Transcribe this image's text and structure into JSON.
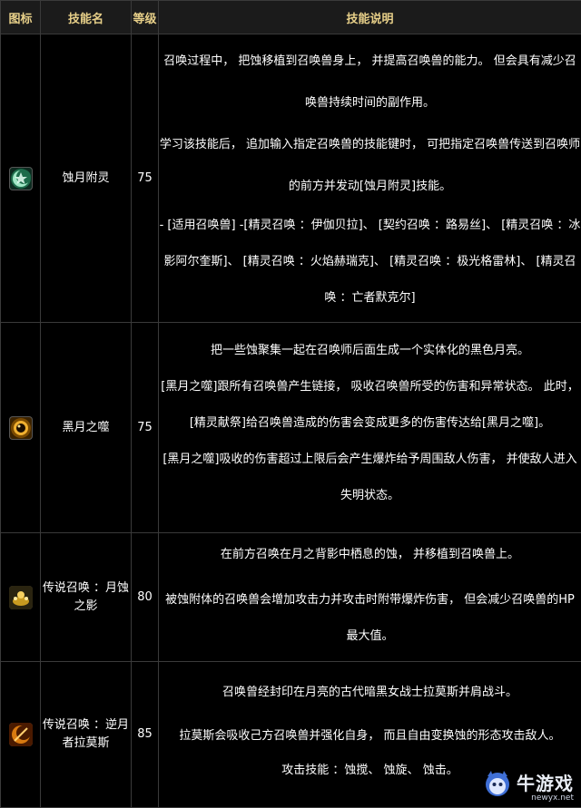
{
  "header": {
    "icon": "图标",
    "name": "技能名",
    "level": "等级",
    "desc": "技能说明"
  },
  "rows": [
    {
      "icon": "moon-star-icon",
      "name": "蚀月附灵",
      "level": "75",
      "desc": [
        "召唤过程中， 把蚀移植到召唤兽身上， 并提高召唤兽的能力。 但会具有减少召唤兽持续时间的副作用。",
        "学习该技能后， 追加输入指定召唤兽的技能键时， 可把指定召唤兽传送到召唤师的前方并发动[蚀月附灵]技能。",
        "- [适用召唤兽] -[精灵召唤 ：伊伽贝拉]、 [契约召唤 ：路易丝]、 [精灵召唤 ：冰影阿尔奎斯]、 [精灵召唤 ：火焰赫瑞克]、 [精灵召唤 ：极光格雷林]、 [精灵召唤 ：亡者默克尔]"
      ]
    },
    {
      "icon": "dark-moon-icon",
      "name": "黑月之噬",
      "level": "75",
      "desc": [
        "把一些蚀聚集一起在召唤师后面生成一个实体化的黑色月亮。",
        "[黑月之噬]跟所有召唤兽产生链接， 吸收召唤兽所受的伤害和异常状态。 此时， [精灵献祭]给召唤兽造成的伤害会变成更多的伤害传达给[黑月之噬]。",
        "[黑月之噬]吸收的伤害超过上限后会产生爆炸给予周围敌人伤害， 并使敌人进入失明状态。"
      ]
    },
    {
      "icon": "shadow-eclipse-icon",
      "name": "传说召唤 ：月蚀之影",
      "level": "80",
      "desc": [
        "在前方召唤在月之背影中栖息的蚀， 并移植到召唤兽上。",
        "被蚀附体的召唤兽会增加攻击力并攻击时附带爆炸伤害， 但会减少召唤兽的HP 最大值。"
      ]
    },
    {
      "icon": "reverse-moon-icon",
      "name": "传说召唤 ：逆月者拉莫斯",
      "level": "85",
      "desc": [
        "召唤曾经封印在月亮的古代暗黑女战士拉莫斯并肩战斗。",
        "拉莫斯会吸收己方召唤兽并强化自身， 而且自由变换蚀的形态攻击敌人。",
        "攻击技能 ：蚀搅、 蚀旋、 蚀击。"
      ]
    }
  ],
  "watermark": {
    "title": "牛游戏",
    "url": "newyx.net",
    "icon": "mascot-logo-icon"
  },
  "colors": {
    "header_text": "#e8d089",
    "border": "#3a3a3a",
    "background": "#000000"
  }
}
